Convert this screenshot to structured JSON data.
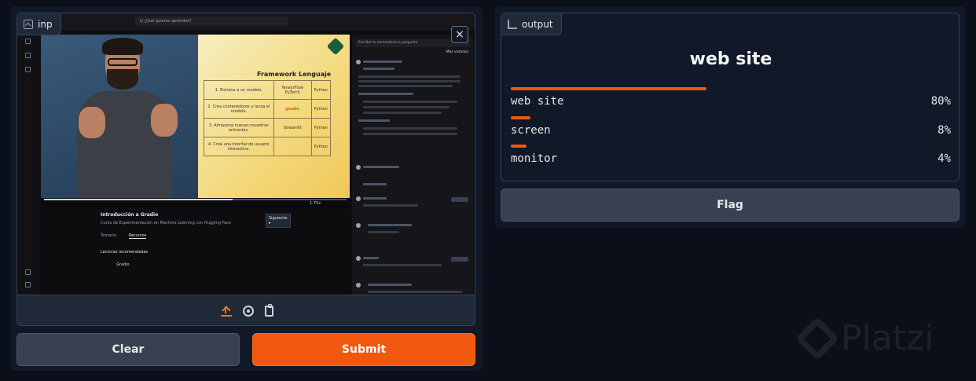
{
  "input": {
    "label": "inp",
    "close_glyph": "×",
    "screenshot": {
      "search_placeholder": "Q ¿Qué quieres aprender?",
      "board": {
        "header_framework": "Framework",
        "header_language": "Lenguaje",
        "steps": [
          "1. Entrena a un modelo.",
          "2. Crea contenedores y lanza el modelo.",
          "3. Almacena nuevas muestras entrantes.",
          "4. Crea una interfaz de usuario interactiva."
        ],
        "frameworks": [
          "TensorFlow PyTorch",
          "gradio",
          "Streamlit"
        ],
        "languages": [
          "Python",
          "Python",
          "Python",
          "Python"
        ]
      },
      "video_time": "1.75x",
      "course_title": "Introducción a Gradio",
      "course_sub": "Curso de Experimentación en Machine Learning con Hugging Face",
      "next_btn": "Siguiente ▸",
      "tabs": [
        "Temario",
        "Recursos"
      ],
      "resources_title": "Lecturas recomendadas",
      "resource_item": "Gradio",
      "comments_placeholder": "Escribe tu comentario o pregunta",
      "comments_sort": "Más votados"
    },
    "toolbar_icons": [
      "upload-icon",
      "webcam-icon",
      "clipboard-icon"
    ]
  },
  "buttons": {
    "clear": "Clear",
    "submit": "Submit",
    "flag": "Flag"
  },
  "output": {
    "label": "output",
    "top_label": "web site",
    "confidences": [
      {
        "label": "web site",
        "value": 0.8,
        "display": "80%"
      },
      {
        "label": "screen",
        "value": 0.08,
        "display": "8%"
      },
      {
        "label": "monitor",
        "value": 0.04,
        "display": "4%"
      }
    ]
  },
  "watermark": "Platzi",
  "colors": {
    "accent": "#f2580d",
    "background": "#0b0f19",
    "panel": "#111827",
    "button": "#374151"
  }
}
